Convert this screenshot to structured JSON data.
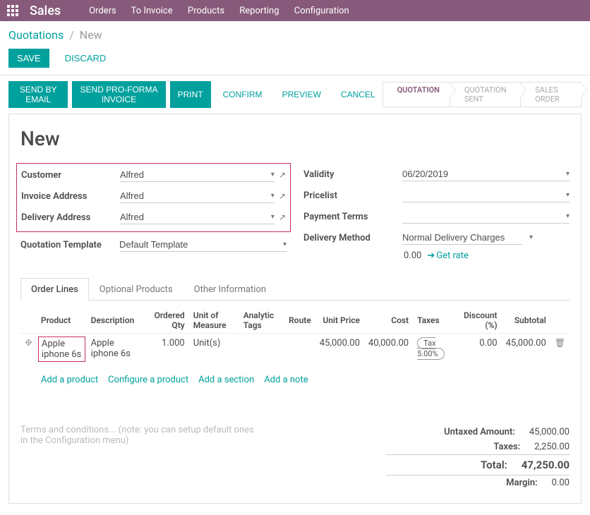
{
  "topbar": {
    "brand": "Sales",
    "menu": [
      "Orders",
      "To Invoice",
      "Products",
      "Reporting",
      "Configuration"
    ]
  },
  "breadcrumb": {
    "root": "Quotations",
    "current": "New"
  },
  "buttons": {
    "save": "SAVE",
    "discard": "DISCARD"
  },
  "actions": {
    "send_email": "SEND BY EMAIL",
    "send_proforma": "SEND PRO-FORMA INVOICE",
    "print": "PRINT",
    "confirm": "CONFIRM",
    "preview": "PREVIEW",
    "cancel": "CANCEL"
  },
  "status": {
    "quotation": "QUOTATION",
    "quotation_sent": "QUOTATION SENT",
    "sales_order": "SALES ORDER"
  },
  "title": "New",
  "fields": {
    "customer_label": "Customer",
    "customer": "Alfred",
    "invoice_addr_label": "Invoice Address",
    "invoice_addr": "Alfred",
    "delivery_addr_label": "Delivery Address",
    "delivery_addr": "Alfred",
    "template_label": "Quotation Template",
    "template": "Default Template",
    "validity_label": "Validity",
    "validity": "06/20/2019",
    "pricelist_label": "Pricelist",
    "pricelist": "",
    "payment_terms_label": "Payment Terms",
    "payment_terms": "",
    "delivery_method_label": "Delivery Method",
    "delivery_method": "Normal Delivery Charges",
    "rate_cost": "0.00",
    "get_rate": "Get rate"
  },
  "tabs": {
    "order_lines": "Order Lines",
    "optional": "Optional Products",
    "other": "Other Information"
  },
  "columns": {
    "product": "Product",
    "description": "Description",
    "qty": "Ordered Qty",
    "uom": "Unit of Measure",
    "analytic": "Analytic Tags",
    "route": "Route",
    "unit_price": "Unit Price",
    "cost": "Cost",
    "taxes": "Taxes",
    "discount": "Discount (%)",
    "subtotal": "Subtotal"
  },
  "lines": [
    {
      "product": "Apple iphone 6s",
      "description": "Apple iphone 6s",
      "qty": "1.000",
      "uom": "Unit(s)",
      "analytic": "",
      "route": "",
      "unit_price": "45,000.00",
      "cost": "40,000.00",
      "taxes": "Tax 5.00%",
      "discount": "0.00",
      "subtotal": "45,000.00"
    }
  ],
  "row_actions": {
    "add_product": "Add a product",
    "configure": "Configure a product",
    "add_section": "Add a section",
    "add_note": "Add a note"
  },
  "terms_placeholder": "Terms and conditions... (note: you can setup default ones in the Configuration menu)",
  "totals": {
    "untaxed_label": "Untaxed Amount:",
    "untaxed": "45,000.00",
    "taxes_label": "Taxes:",
    "taxes": "2,250.00",
    "total_label": "Total:",
    "total": "47,250.00",
    "margin_label": "Margin:",
    "margin": "0.00"
  }
}
